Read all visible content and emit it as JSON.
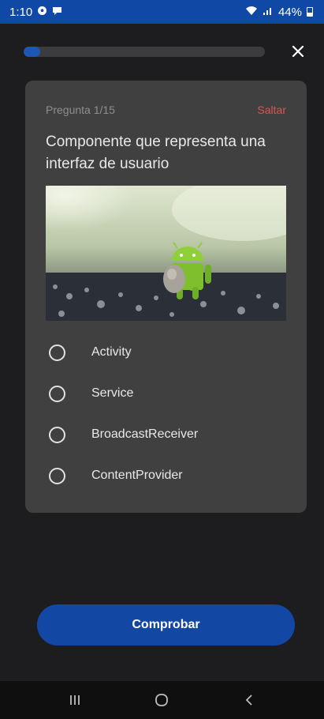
{
  "status_bar": {
    "time": "1:10",
    "battery_percent": "44%",
    "left_icons": [
      "soccer-ball-icon",
      "chat-bubble-icon"
    ],
    "right_icons": [
      "wifi-icon",
      "signal-icon",
      "battery-icon"
    ]
  },
  "quiz": {
    "progress_fraction": 0.067,
    "progress_color": "#1d57b5",
    "counter": "Pregunta 1/15",
    "skip_label": "Saltar",
    "question": "Componente que representa una interfaz de usuario",
    "options": [
      {
        "label": "Activity"
      },
      {
        "label": "Service"
      },
      {
        "label": "BroadcastReceiver"
      },
      {
        "label": "ContentProvider"
      }
    ]
  },
  "actions": {
    "check_label": "Comprobar"
  },
  "colors": {
    "accent": "#1248a3",
    "skip": "#e05252",
    "card": "#404040",
    "background": "#1d1d1f"
  }
}
